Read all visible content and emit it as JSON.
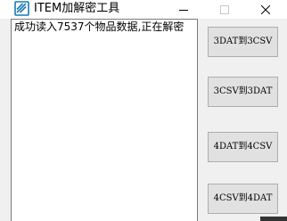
{
  "window": {
    "title": "ITEM加解密工具",
    "icon": "app-icon"
  },
  "controls": {
    "minimize": "minimize-icon",
    "maximize": "maximize-icon",
    "close": "close-icon"
  },
  "log": {
    "text": "成功读入7537个物品数据,正在解密"
  },
  "buttons": {
    "dat_to_csv_3": "3DAT到3CSV",
    "csv_to_dat_3": "3CSV到3DAT",
    "dat_to_csv_4": "4DAT到4CSV",
    "csv_to_dat_4": "4CSV到4DAT"
  },
  "colors": {
    "icon_accent": "#1a7ab0",
    "button_bg": "#e1e1e1",
    "button_border": "#adadad",
    "window_bg": "#f0f0f0"
  }
}
